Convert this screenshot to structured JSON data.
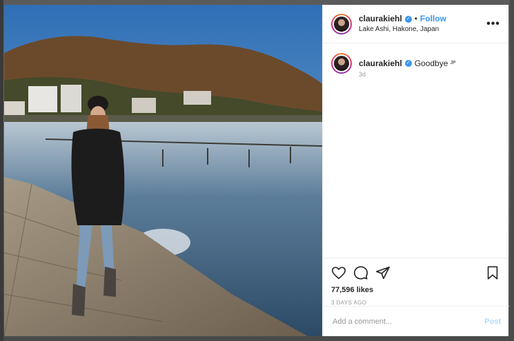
{
  "post": {
    "username": "claurakiehl",
    "verified": true,
    "follow_label": "Follow",
    "location": "Lake Ashi, Hakone, Japan",
    "more_label": "•••"
  },
  "caption": {
    "username": "claurakiehl",
    "text": "Goodbye",
    "flag": "JP",
    "time": "3d"
  },
  "actions": {
    "likes": "77,596 likes",
    "posted_ago": "3 DAYS AGO"
  },
  "comment_box": {
    "placeholder": "Add a comment...",
    "post_label": "Post"
  },
  "colors": {
    "accent": "#3897f0",
    "post_disabled": "#b3dbff"
  },
  "icons": [
    "heart-icon",
    "comment-icon",
    "share-icon",
    "bookmark-icon",
    "verified-badge-icon",
    "more-options-icon"
  ]
}
